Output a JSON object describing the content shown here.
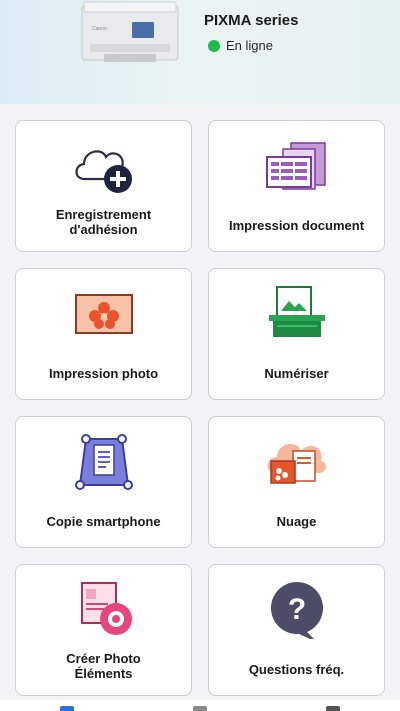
{
  "header": {
    "printer_name": "PIXMA series",
    "status_text": "En ligne",
    "status_color": "#1fb84a"
  },
  "tiles": [
    {
      "label": "Enregistrement\nd'adhésion",
      "icon": "cloud-plus-icon"
    },
    {
      "label": "Impression document",
      "icon": "document-print-icon"
    },
    {
      "label": "Impression photo",
      "icon": "photo-print-icon"
    },
    {
      "label": "Numériser",
      "icon": "scan-icon"
    },
    {
      "label": "Copie smartphone",
      "icon": "smartphone-copy-icon"
    },
    {
      "label": "Nuage",
      "icon": "cloud-icon"
    },
    {
      "label": "Créer Photo\nÉléments",
      "icon": "photo-elements-icon"
    },
    {
      "label": "Questions fréq.",
      "icon": "faq-icon"
    }
  ],
  "bottom_nav": {
    "icons": [
      "home-icon",
      "info-icon",
      "menu-icon"
    ],
    "accent": "#2a6fdb"
  }
}
